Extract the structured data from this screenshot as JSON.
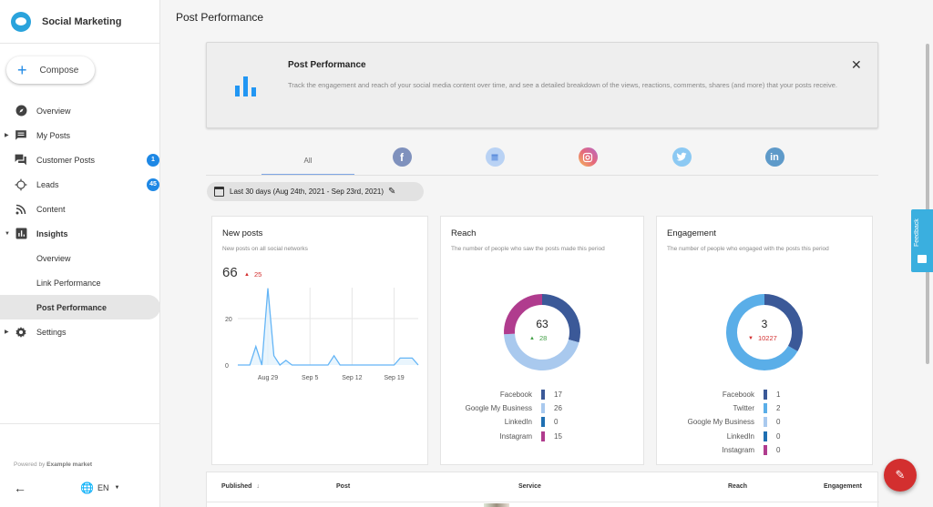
{
  "sidebar": {
    "brand": "Social Marketing",
    "compose_label": "Compose",
    "items": [
      {
        "label": "Overview",
        "icon": "compass-icon"
      },
      {
        "label": "My Posts",
        "icon": "post-icon",
        "expandable": true
      },
      {
        "label": "Customer Posts",
        "icon": "chat-icon",
        "badge": "1"
      },
      {
        "label": "Leads",
        "icon": "crosshair-icon",
        "badge": "45"
      },
      {
        "label": "Content",
        "icon": "rss-icon"
      },
      {
        "label": "Insights",
        "icon": "chart-icon",
        "expanded": true
      },
      {
        "label": "Overview",
        "sub": true
      },
      {
        "label": "Link Performance",
        "sub": true
      },
      {
        "label": "Post Performance",
        "sub": true,
        "active": true
      },
      {
        "label": "Settings",
        "icon": "gear-icon",
        "expandable": true
      }
    ],
    "footer": {
      "powered_prefix": "Powered by",
      "powered_brand": "Example market",
      "language": "EN"
    }
  },
  "header": {
    "title": "Post Performance"
  },
  "banner": {
    "title": "Post Performance",
    "description": "Track the engagement and reach of your social media content over time, and see a detailed breakdown of the views, reactions, comments, shares (and more) that your posts receive."
  },
  "tabs": [
    {
      "label": "All",
      "active": true
    },
    {
      "label": "Facebook",
      "icon": "facebook-icon",
      "color": "#3b5998"
    },
    {
      "label": "Google My Business",
      "icon": "google-my-business-icon",
      "color": "#8ab4f8"
    },
    {
      "label": "Instagram",
      "icon": "instagram-icon",
      "color": "#e1306c"
    },
    {
      "label": "Twitter",
      "icon": "twitter-icon",
      "color": "#55acee"
    },
    {
      "label": "LinkedIn",
      "icon": "linkedin-icon",
      "color": "#0e76a8"
    }
  ],
  "date_range": "Last 30 days (Aug 24th, 2021 - Sep 23rd, 2021)",
  "cards": {
    "new_posts": {
      "title": "New posts",
      "subtitle": "New posts on all social networks",
      "total": "66",
      "delta": "25",
      "delta_direction": "up"
    },
    "reach": {
      "title": "Reach",
      "subtitle": "The number of people who saw the posts made this period",
      "total": "63",
      "delta": "28",
      "delta_direction": "up"
    },
    "engagement": {
      "title": "Engagement",
      "subtitle": "The number of people who engaged with the posts this period",
      "total": "3",
      "delta": "10227",
      "delta_direction": "down"
    }
  },
  "chart_data": [
    {
      "type": "area",
      "title": "New posts",
      "x_tick_labels": [
        "Aug 29",
        "Sep 5",
        "Sep 12",
        "Sep 19"
      ],
      "y_tick_labels": [
        "0",
        "20"
      ],
      "ylim": [
        0,
        33
      ],
      "x": [
        "Aug 24",
        "Aug 25",
        "Aug 26",
        "Aug 27",
        "Aug 28",
        "Aug 29",
        "Aug 30",
        "Aug 31",
        "Sep 1",
        "Sep 2",
        "Sep 3",
        "Sep 4",
        "Sep 5",
        "Sep 6",
        "Sep 7",
        "Sep 8",
        "Sep 9",
        "Sep 10",
        "Sep 11",
        "Sep 12",
        "Sep 13",
        "Sep 14",
        "Sep 15",
        "Sep 16",
        "Sep 17",
        "Sep 18",
        "Sep 19",
        "Sep 20",
        "Sep 21",
        "Sep 22",
        "Sep 23"
      ],
      "values": [
        0,
        0,
        0,
        8,
        0,
        33,
        4,
        0,
        2,
        0,
        0,
        0,
        0,
        0,
        0,
        0,
        4,
        0,
        0,
        0,
        0,
        0,
        0,
        0,
        0,
        0,
        0,
        3,
        3,
        3,
        0
      ],
      "color": "#64b5f6",
      "grid": true
    },
    {
      "type": "pie",
      "title": "Reach",
      "donut": true,
      "labels": [
        "Facebook",
        "Google My Business",
        "LinkedIn",
        "Instagram"
      ],
      "values": [
        17,
        26,
        0,
        15
      ],
      "colors": [
        "#3b5998",
        "#a9c9ee",
        "#1f6fb2",
        "#b03c8e"
      ]
    },
    {
      "type": "pie",
      "title": "Engagement",
      "donut": true,
      "labels": [
        "Facebook",
        "Twitter",
        "Google My Business",
        "LinkedIn",
        "Instagram"
      ],
      "values": [
        1,
        2,
        0,
        0,
        0
      ],
      "colors": [
        "#3b5998",
        "#5aaee8",
        "#a9c9ee",
        "#1f6fb2",
        "#b03c8e"
      ]
    }
  ],
  "table": {
    "columns": [
      "Published",
      "Post",
      "Service",
      "Reach",
      "Engagement"
    ],
    "sort_column": "Published",
    "sort_direction": "desc"
  },
  "feedback_label": "Feedback"
}
